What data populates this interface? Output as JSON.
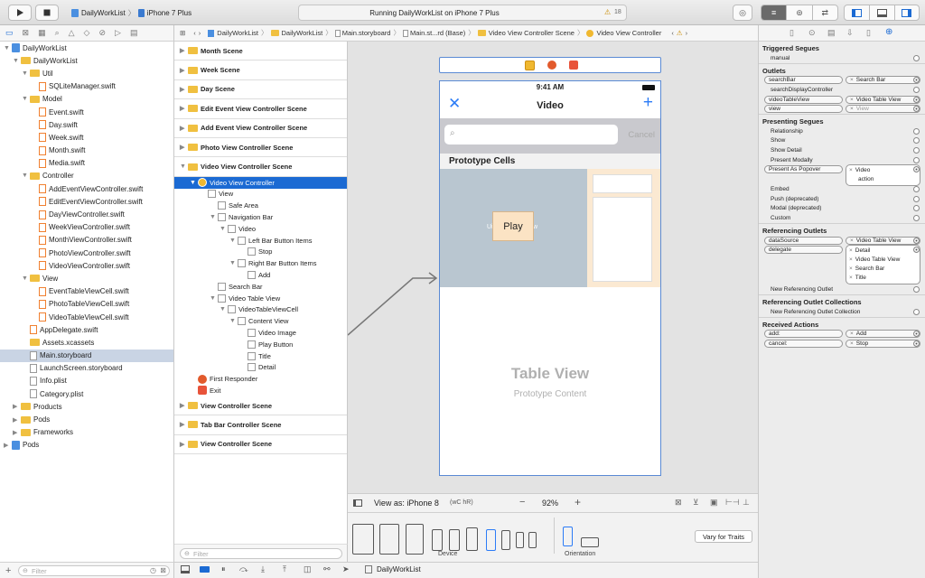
{
  "toolbar": {
    "scheme": "DailyWorkList",
    "device": "iPhone 7 Plus",
    "status": "Running DailyWorkList on iPhone 7 Plus",
    "warnings": "18"
  },
  "jumpbar": {
    "crumbs": [
      "DailyWorkList",
      "DailyWorkList",
      "Main.storyboard",
      "Main.st...rd (Base)",
      "Video View Controller Scene",
      "Video View Controller"
    ]
  },
  "navigator": {
    "items": [
      {
        "label": "DailyWorkList",
        "indent": 0,
        "kind": "project",
        "open": true
      },
      {
        "label": "DailyWorkList",
        "indent": 1,
        "kind": "folder",
        "open": true
      },
      {
        "label": "Util",
        "indent": 2,
        "kind": "folder",
        "open": true
      },
      {
        "label": "SQLiteManager.swift",
        "indent": 3,
        "kind": "swift"
      },
      {
        "label": "Model",
        "indent": 2,
        "kind": "folder",
        "open": true
      },
      {
        "label": "Event.swift",
        "indent": 3,
        "kind": "swift"
      },
      {
        "label": "Day.swift",
        "indent": 3,
        "kind": "swift"
      },
      {
        "label": "Week.swift",
        "indent": 3,
        "kind": "swift"
      },
      {
        "label": "Month.swift",
        "indent": 3,
        "kind": "swift"
      },
      {
        "label": "Media.swift",
        "indent": 3,
        "kind": "swift"
      },
      {
        "label": "Controller",
        "indent": 2,
        "kind": "folder",
        "open": true
      },
      {
        "label": "AddEventViewController.swift",
        "indent": 3,
        "kind": "swift"
      },
      {
        "label": "EditEventViewController.swift",
        "indent": 3,
        "kind": "swift"
      },
      {
        "label": "DayViewController.swift",
        "indent": 3,
        "kind": "swift"
      },
      {
        "label": "WeekViewController.swift",
        "indent": 3,
        "kind": "swift"
      },
      {
        "label": "MonthViewController.swift",
        "indent": 3,
        "kind": "swift"
      },
      {
        "label": "PhotoViewController.swift",
        "indent": 3,
        "kind": "swift"
      },
      {
        "label": "VideoViewController.swift",
        "indent": 3,
        "kind": "swift"
      },
      {
        "label": "View",
        "indent": 2,
        "kind": "folder",
        "open": true
      },
      {
        "label": "EventTableViewCell.swift",
        "indent": 3,
        "kind": "swift"
      },
      {
        "label": "PhotoTableViewCell.swift",
        "indent": 3,
        "kind": "swift"
      },
      {
        "label": "VideoTableViewCell.swift",
        "indent": 3,
        "kind": "swift"
      },
      {
        "label": "AppDelegate.swift",
        "indent": 2,
        "kind": "swift"
      },
      {
        "label": "Assets.xcassets",
        "indent": 2,
        "kind": "folder"
      },
      {
        "label": "Main.storyboard",
        "indent": 2,
        "kind": "file",
        "selected": true
      },
      {
        "label": "LaunchScreen.storyboard",
        "indent": 2,
        "kind": "file"
      },
      {
        "label": "Info.plist",
        "indent": 2,
        "kind": "file"
      },
      {
        "label": "Category.plist",
        "indent": 2,
        "kind": "file"
      },
      {
        "label": "Products",
        "indent": 1,
        "kind": "folder",
        "open": false
      },
      {
        "label": "Pods",
        "indent": 1,
        "kind": "folder",
        "open": false
      },
      {
        "label": "Frameworks",
        "indent": 1,
        "kind": "folder",
        "open": false
      },
      {
        "label": "Pods",
        "indent": 0,
        "kind": "project",
        "open": false
      }
    ],
    "filter_placeholder": "Filter"
  },
  "outline": {
    "items": [
      {
        "label": "Month Scene",
        "indent": 0,
        "kind": "scene"
      },
      {
        "label": "Week Scene",
        "indent": 0,
        "kind": "scene"
      },
      {
        "label": "Day Scene",
        "indent": 0,
        "kind": "scene"
      },
      {
        "label": "Edit Event View Controller Scene",
        "indent": 0,
        "kind": "scene"
      },
      {
        "label": "Add Event View Controller Scene",
        "indent": 0,
        "kind": "scene"
      },
      {
        "label": "Photo View Controller Scene",
        "indent": 0,
        "kind": "scene"
      },
      {
        "label": "Video View Controller Scene",
        "indent": 0,
        "kind": "scene",
        "open": true
      },
      {
        "label": "Video View Controller",
        "indent": 1,
        "kind": "vc",
        "selected": true
      },
      {
        "label": "View",
        "indent": 2,
        "kind": "item"
      },
      {
        "label": "Safe Area",
        "indent": 3,
        "kind": "item"
      },
      {
        "label": "Navigation Bar",
        "indent": 3,
        "kind": "item"
      },
      {
        "label": "Video",
        "indent": 4,
        "kind": "item"
      },
      {
        "label": "Left Bar Button Items",
        "indent": 5,
        "kind": "item"
      },
      {
        "label": "Stop",
        "indent": 6,
        "kind": "item"
      },
      {
        "label": "Right Bar Button Items",
        "indent": 5,
        "kind": "item"
      },
      {
        "label": "Add",
        "indent": 6,
        "kind": "item"
      },
      {
        "label": "Search Bar",
        "indent": 3,
        "kind": "item"
      },
      {
        "label": "Video Table View",
        "indent": 3,
        "kind": "item"
      },
      {
        "label": "VideoTableViewCell",
        "indent": 4,
        "kind": "item"
      },
      {
        "label": "Content View",
        "indent": 5,
        "kind": "item"
      },
      {
        "label": "Video Image",
        "indent": 6,
        "kind": "item"
      },
      {
        "label": "Play Button",
        "indent": 6,
        "kind": "item"
      },
      {
        "label": "Title",
        "indent": 6,
        "kind": "item"
      },
      {
        "label": "Detail",
        "indent": 6,
        "kind": "item"
      },
      {
        "label": "First Responder",
        "indent": 1,
        "kind": "vc2"
      },
      {
        "label": "Exit",
        "indent": 1,
        "kind": "vc3"
      },
      {
        "label": "View Controller Scene",
        "indent": 0,
        "kind": "scene"
      },
      {
        "label": "Tab Bar Controller Scene",
        "indent": 0,
        "kind": "scene"
      },
      {
        "label": "View Controller Scene",
        "indent": 0,
        "kind": "scene"
      }
    ],
    "filter_placeholder": "Filter"
  },
  "phone": {
    "time": "9:41 AM",
    "nav_title": "Video",
    "search_cancel": "Cancel",
    "section_header": "Prototype Cells",
    "play_button": "Play",
    "table_title": "Table View",
    "table_subtitle": "Prototype Content"
  },
  "bottom": {
    "view_as": "View as: iPhone 8",
    "view_as_suffix": "(wC hR)",
    "zoom": "92%",
    "device_label": "Device",
    "orientation_label": "Orientation",
    "vary_button": "Vary for Traits"
  },
  "debug": {
    "target": "DailyWorkList"
  },
  "inspector": {
    "triggered_title": "Triggered Segues",
    "manual": "manual",
    "outlets_title": "Outlets",
    "outlets": [
      {
        "name": "searchBar",
        "target": "Search Bar"
      },
      {
        "name": "searchDisplayController",
        "target": ""
      },
      {
        "name": "videoTableView",
        "target": "Video Table View"
      },
      {
        "name": "view",
        "target": "View"
      }
    ],
    "presenting_title": "Presenting Segues",
    "presenting": [
      "Relationship",
      "Show",
      "Show Detail",
      "Present Modally",
      "Present As Popover",
      "Embed",
      "Push (deprecated)",
      "Modal (deprecated)",
      "Custom"
    ],
    "popover_target": [
      "Video",
      "action"
    ],
    "ref_outlets_title": "Referencing Outlets",
    "ref_datasource": "dataSource",
    "ref_datasource_target": "Video Table View",
    "ref_delegate": "delegate",
    "ref_delegate_targets": [
      "Detail",
      "Video Table View",
      "Search Bar",
      "Title"
    ],
    "new_ref_outlet": "New Referencing Outlet",
    "ref_collections_title": "Referencing Outlet Collections",
    "new_ref_collection": "New Referencing Outlet Collection",
    "actions_title": "Received Actions",
    "actions": [
      {
        "name": "add:",
        "target": "Add"
      },
      {
        "name": "cancel:",
        "target": "Stop"
      }
    ]
  },
  "colors": {
    "accent": "#1b6ad3",
    "ios_blue": "#2c7cf6",
    "cell_bg": "#b9c6d0"
  }
}
